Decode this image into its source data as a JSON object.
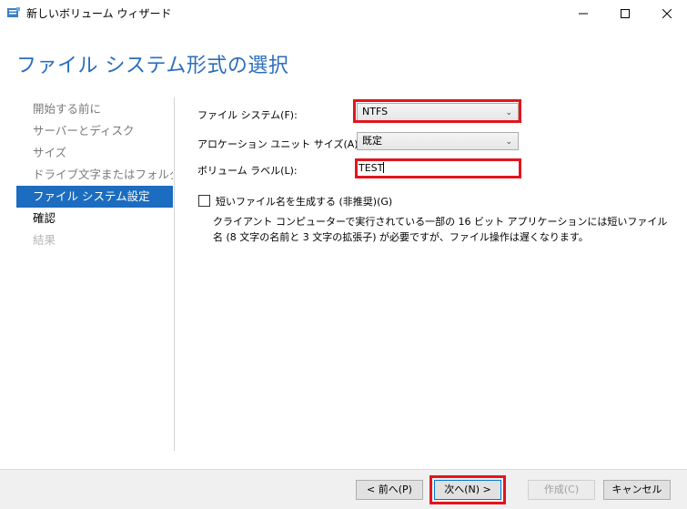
{
  "window": {
    "title": "新しいボリューム ウィザード"
  },
  "page": {
    "heading": "ファイル システム形式の選択"
  },
  "steps": [
    {
      "label": "開始する前に",
      "state": "done"
    },
    {
      "label": "サーバーとディスク",
      "state": "done"
    },
    {
      "label": "サイズ",
      "state": "done"
    },
    {
      "label": "ドライブ文字またはフォルダー",
      "state": "done"
    },
    {
      "label": "ファイル システム設定",
      "state": "active"
    },
    {
      "label": "確認",
      "state": "upcoming"
    },
    {
      "label": "結果",
      "state": "disabled"
    }
  ],
  "form": {
    "filesystem_label": "ファイル システム(F):",
    "filesystem_value": "NTFS",
    "allocation_label": "アロケーション ユニット サイズ(A):",
    "allocation_value": "既定",
    "volume_label_label": "ボリューム ラベル(L):",
    "volume_label_value": "TEST",
    "short_names_label": "短いファイル名を生成する (非推奨)(G)",
    "short_names_checked": false,
    "short_names_desc": "クライアント コンピューターで実行されている一部の 16 ビット アプリケーションには短いファイル名 (8 文字の名前と 3 文字の拡張子) が必要ですが、ファイル操作は遅くなります。"
  },
  "buttons": {
    "prev": "< 前へ(P)",
    "next": "次へ(N) >",
    "create": "作成(C)",
    "cancel": "キャンセル"
  },
  "colors": {
    "accent": "#1c6cbf",
    "heading": "#2a6ebd",
    "highlight": "#e4141e"
  }
}
